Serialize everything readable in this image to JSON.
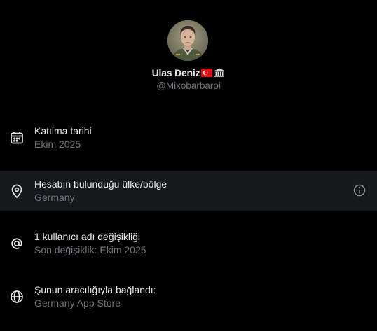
{
  "profile": {
    "display_name": "Ulas Deniz",
    "handle": "@Mixobarbaroi",
    "name_emojis": [
      "turkish-flag-icon",
      "classical-building-icon"
    ]
  },
  "details": [
    {
      "icon": "calendar-icon",
      "title": "Katılma tarihi",
      "subtitle": "Ekim 2025"
    },
    {
      "icon": "location-pin-icon",
      "title": "Hesabın bulunduğu ülke/bölge",
      "subtitle": "Germany",
      "trailing_icon": "info-icon",
      "highlighted": true
    },
    {
      "icon": "at-sign-icon",
      "title": "1 kullanıcı adı değişikliği",
      "subtitle": "Son değişiklik: Ekim 2025"
    },
    {
      "icon": "globe-icon",
      "title": "Şunun aracılığıyla bağlandı:",
      "subtitle": "Germany App Store"
    }
  ],
  "colors": {
    "background": "#000000",
    "highlight_row": "#16181c",
    "primary_text": "#e7e9ea",
    "secondary_text": "#71767b"
  }
}
